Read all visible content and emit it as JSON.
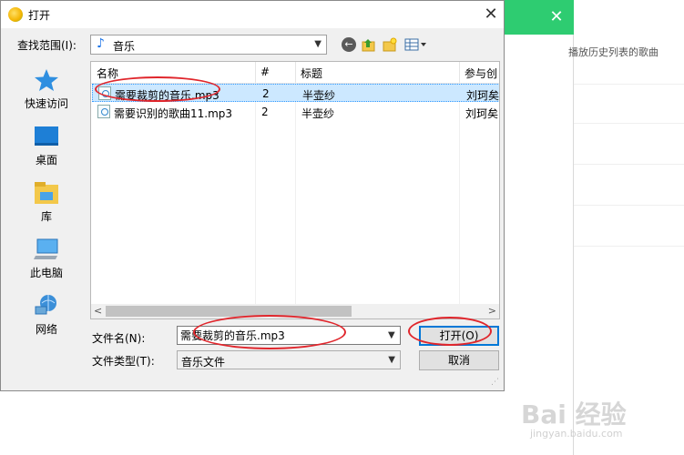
{
  "background_app": {
    "close_glyph": "✕",
    "hint": "播放历史列表的歌曲"
  },
  "dialog": {
    "title": "打开",
    "close_glyph": "✕",
    "look_in": {
      "label": "查找范围(I):",
      "value": "音乐"
    },
    "places": [
      {
        "label": "快速访问",
        "icon": "star-icon"
      },
      {
        "label": "桌面",
        "icon": "desktop-icon"
      },
      {
        "label": "库",
        "icon": "library-icon"
      },
      {
        "label": "此电脑",
        "icon": "computer-icon"
      },
      {
        "label": "网络",
        "icon": "network-icon"
      }
    ],
    "columns": [
      "名称",
      "#",
      "标题",
      "参与创"
    ],
    "files": [
      {
        "name": "需要裁剪的音乐.mp3",
        "num": "2",
        "title": "半壶纱",
        "artist": "刘珂矣",
        "selected": true
      },
      {
        "name": "需要识别的歌曲11.mp3",
        "num": "2",
        "title": "半壶纱",
        "artist": "刘珂矣",
        "selected": false
      }
    ],
    "file_name": {
      "label": "文件名(N):",
      "value": "需要裁剪的音乐.mp3"
    },
    "file_type": {
      "label": "文件类型(T):",
      "value": "音乐文件"
    },
    "open_label": "打开(O)",
    "cancel_label": "取消"
  },
  "watermark": {
    "brand": "Bai 经验",
    "url": "jingyan.baidu.com"
  },
  "colors": {
    "accent_green": "#2ecc71",
    "selection": "#cce8ff",
    "annotation_red": "#e0262c",
    "focus_blue": "#0078d7"
  }
}
